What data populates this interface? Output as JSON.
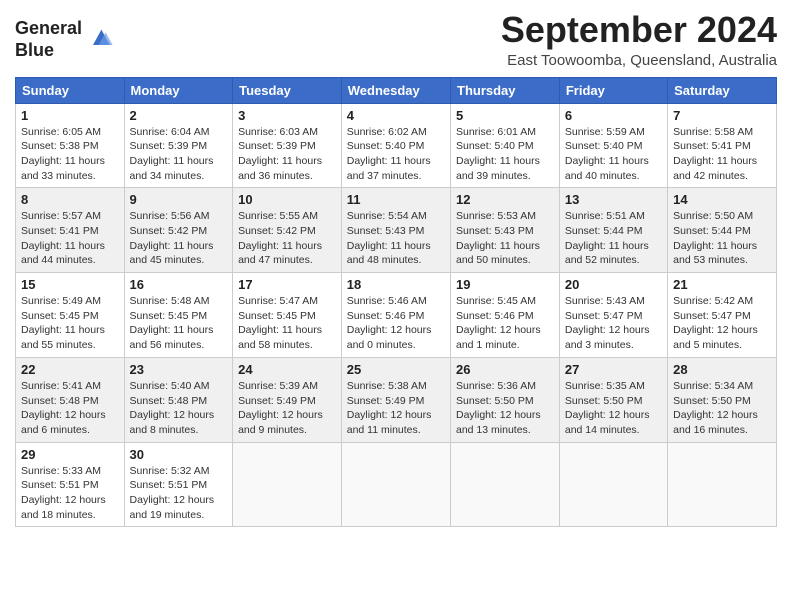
{
  "header": {
    "logo_line1": "General",
    "logo_line2": "Blue",
    "month": "September 2024",
    "location": "East Toowoomba, Queensland, Australia"
  },
  "weekdays": [
    "Sunday",
    "Monday",
    "Tuesday",
    "Wednesday",
    "Thursday",
    "Friday",
    "Saturday"
  ],
  "weeks": [
    [
      {
        "day": "1",
        "info": "Sunrise: 6:05 AM\nSunset: 5:38 PM\nDaylight: 11 hours\nand 33 minutes."
      },
      {
        "day": "2",
        "info": "Sunrise: 6:04 AM\nSunset: 5:39 PM\nDaylight: 11 hours\nand 34 minutes."
      },
      {
        "day": "3",
        "info": "Sunrise: 6:03 AM\nSunset: 5:39 PM\nDaylight: 11 hours\nand 36 minutes."
      },
      {
        "day": "4",
        "info": "Sunrise: 6:02 AM\nSunset: 5:40 PM\nDaylight: 11 hours\nand 37 minutes."
      },
      {
        "day": "5",
        "info": "Sunrise: 6:01 AM\nSunset: 5:40 PM\nDaylight: 11 hours\nand 39 minutes."
      },
      {
        "day": "6",
        "info": "Sunrise: 5:59 AM\nSunset: 5:40 PM\nDaylight: 11 hours\nand 40 minutes."
      },
      {
        "day": "7",
        "info": "Sunrise: 5:58 AM\nSunset: 5:41 PM\nDaylight: 11 hours\nand 42 minutes."
      }
    ],
    [
      {
        "day": "8",
        "info": "Sunrise: 5:57 AM\nSunset: 5:41 PM\nDaylight: 11 hours\nand 44 minutes."
      },
      {
        "day": "9",
        "info": "Sunrise: 5:56 AM\nSunset: 5:42 PM\nDaylight: 11 hours\nand 45 minutes."
      },
      {
        "day": "10",
        "info": "Sunrise: 5:55 AM\nSunset: 5:42 PM\nDaylight: 11 hours\nand 47 minutes."
      },
      {
        "day": "11",
        "info": "Sunrise: 5:54 AM\nSunset: 5:43 PM\nDaylight: 11 hours\nand 48 minutes."
      },
      {
        "day": "12",
        "info": "Sunrise: 5:53 AM\nSunset: 5:43 PM\nDaylight: 11 hours\nand 50 minutes."
      },
      {
        "day": "13",
        "info": "Sunrise: 5:51 AM\nSunset: 5:44 PM\nDaylight: 11 hours\nand 52 minutes."
      },
      {
        "day": "14",
        "info": "Sunrise: 5:50 AM\nSunset: 5:44 PM\nDaylight: 11 hours\nand 53 minutes."
      }
    ],
    [
      {
        "day": "15",
        "info": "Sunrise: 5:49 AM\nSunset: 5:45 PM\nDaylight: 11 hours\nand 55 minutes."
      },
      {
        "day": "16",
        "info": "Sunrise: 5:48 AM\nSunset: 5:45 PM\nDaylight: 11 hours\nand 56 minutes."
      },
      {
        "day": "17",
        "info": "Sunrise: 5:47 AM\nSunset: 5:45 PM\nDaylight: 11 hours\nand 58 minutes."
      },
      {
        "day": "18",
        "info": "Sunrise: 5:46 AM\nSunset: 5:46 PM\nDaylight: 12 hours\nand 0 minutes."
      },
      {
        "day": "19",
        "info": "Sunrise: 5:45 AM\nSunset: 5:46 PM\nDaylight: 12 hours\nand 1 minute."
      },
      {
        "day": "20",
        "info": "Sunrise: 5:43 AM\nSunset: 5:47 PM\nDaylight: 12 hours\nand 3 minutes."
      },
      {
        "day": "21",
        "info": "Sunrise: 5:42 AM\nSunset: 5:47 PM\nDaylight: 12 hours\nand 5 minutes."
      }
    ],
    [
      {
        "day": "22",
        "info": "Sunrise: 5:41 AM\nSunset: 5:48 PM\nDaylight: 12 hours\nand 6 minutes."
      },
      {
        "day": "23",
        "info": "Sunrise: 5:40 AM\nSunset: 5:48 PM\nDaylight: 12 hours\nand 8 minutes."
      },
      {
        "day": "24",
        "info": "Sunrise: 5:39 AM\nSunset: 5:49 PM\nDaylight: 12 hours\nand 9 minutes."
      },
      {
        "day": "25",
        "info": "Sunrise: 5:38 AM\nSunset: 5:49 PM\nDaylight: 12 hours\nand 11 minutes."
      },
      {
        "day": "26",
        "info": "Sunrise: 5:36 AM\nSunset: 5:50 PM\nDaylight: 12 hours\nand 13 minutes."
      },
      {
        "day": "27",
        "info": "Sunrise: 5:35 AM\nSunset: 5:50 PM\nDaylight: 12 hours\nand 14 minutes."
      },
      {
        "day": "28",
        "info": "Sunrise: 5:34 AM\nSunset: 5:50 PM\nDaylight: 12 hours\nand 16 minutes."
      }
    ],
    [
      {
        "day": "29",
        "info": "Sunrise: 5:33 AM\nSunset: 5:51 PM\nDaylight: 12 hours\nand 18 minutes."
      },
      {
        "day": "30",
        "info": "Sunrise: 5:32 AM\nSunset: 5:51 PM\nDaylight: 12 hours\nand 19 minutes."
      },
      {
        "day": "",
        "info": ""
      },
      {
        "day": "",
        "info": ""
      },
      {
        "day": "",
        "info": ""
      },
      {
        "day": "",
        "info": ""
      },
      {
        "day": "",
        "info": ""
      }
    ]
  ]
}
